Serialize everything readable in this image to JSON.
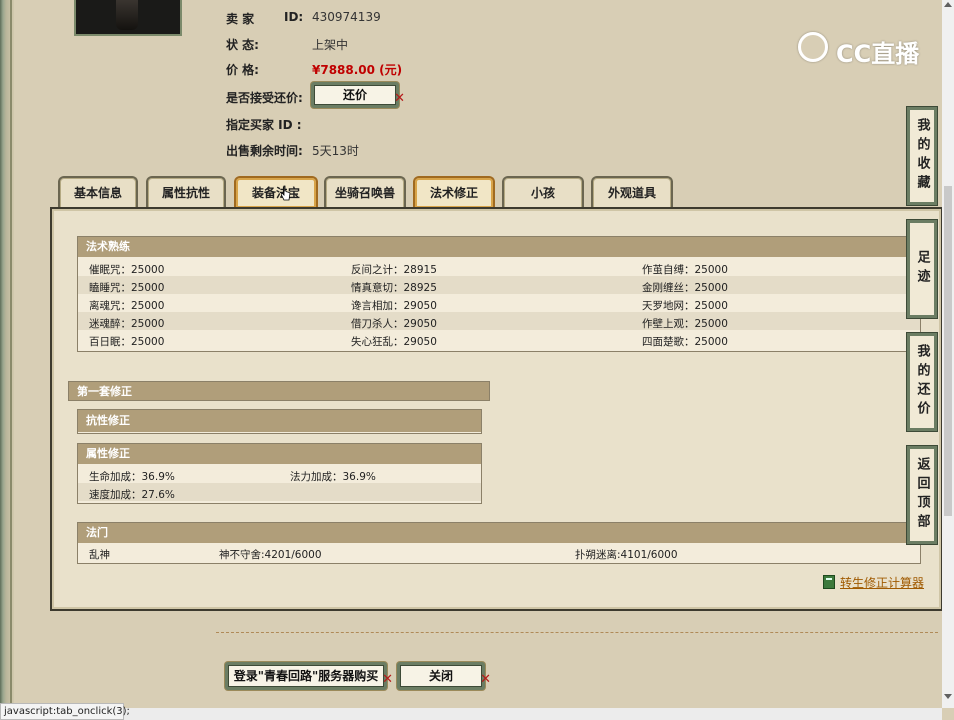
{
  "seller": {
    "label_seller": "卖 家",
    "label_id": "ID:",
    "id_value": "430974139",
    "label_status": "状 态:",
    "status_value": "上架中",
    "label_price": "价 格:",
    "price_value": "¥7888.00 (元)",
    "label_counter": "是否接受还价:",
    "counter_button": "还价",
    "label_buyer": "指定买家 ID :",
    "label_time": "出售剩余时间:",
    "time_value": "5天13时"
  },
  "tabs": [
    {
      "label": "基本信息"
    },
    {
      "label": "属性抗性"
    },
    {
      "label": "装备法宝"
    },
    {
      "label": "坐骑召唤兽"
    },
    {
      "label": "法术修正"
    },
    {
      "label": "小孩"
    },
    {
      "label": "外观道具"
    }
  ],
  "spell_skill": {
    "title": "法术熟练",
    "rows": [
      [
        "催眠咒：25000",
        "反间之计：28915",
        "作茧自缚：25000"
      ],
      [
        "瞌睡咒：25000",
        "情真意切：28925",
        "金刚缠丝：25000"
      ],
      [
        "离魂咒：25000",
        "谗言相加：29050",
        "天罗地网：25000"
      ],
      [
        "迷魂醉：25000",
        "借刀杀人：29050",
        "作壁上观：25000"
      ],
      [
        "百日眠：25000",
        "失心狂乱：29050",
        "四面楚歌：25000"
      ]
    ]
  },
  "correction": {
    "title": "第一套修正",
    "resist_title": "抗性修正",
    "attr_title": "属性修正",
    "attr_rows": [
      [
        "生命加成：36.9%",
        "法力加成：36.9%"
      ],
      [
        "速度加成：27.6%",
        ""
      ]
    ]
  },
  "fa_men": {
    "title": "法门",
    "cells": [
      "乱神",
      "神不守舍:4201/6000",
      "扑朔迷离:4101/6000"
    ]
  },
  "calculator_link": "转生修正计算器",
  "bottom_buttons": {
    "login_buy": "登录\"青春回路\"服务器购买",
    "close": "关闭"
  },
  "side_buttons": [
    {
      "label": "我的收藏"
    },
    {
      "label": "足迹"
    },
    {
      "label": "我的还价"
    },
    {
      "label": "返回顶部"
    }
  ],
  "status_bar": "javascript:tab_onclick(3);",
  "watermark": "CC直播",
  "colors": {
    "price_red": "#c00000",
    "section_header": "#b09e7a",
    "button_border": "#6b7d63",
    "active_tab_border": "#a06a20",
    "link": "#a05a00"
  }
}
